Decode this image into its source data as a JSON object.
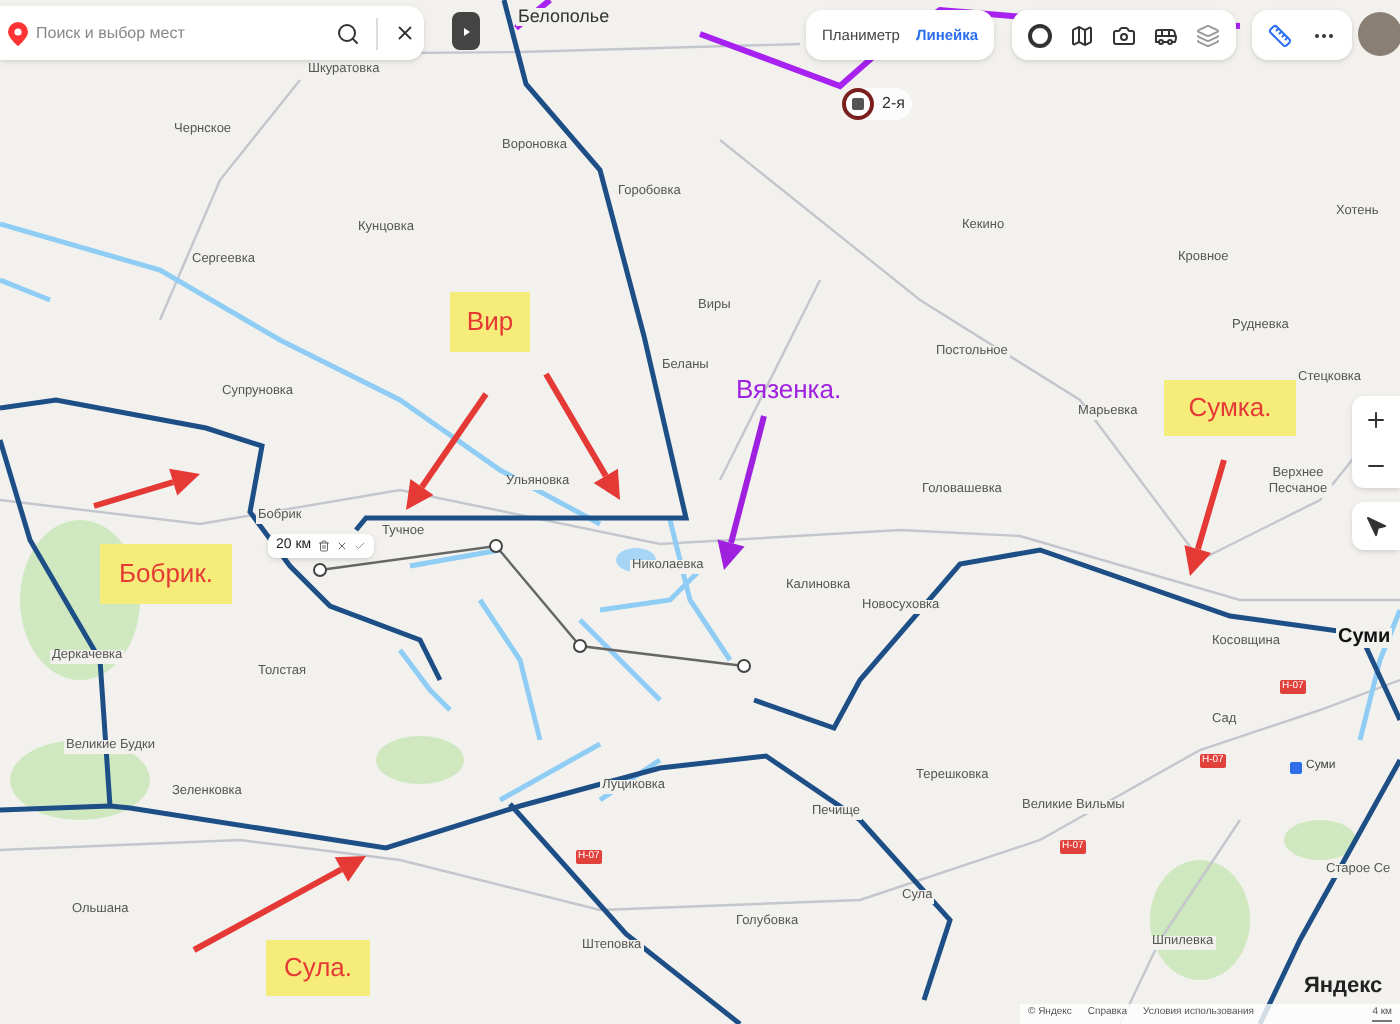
{
  "search": {
    "placeholder": "Поиск и выбор мест"
  },
  "measure_tabs": [
    {
      "label": "Планиметр",
      "selected": false
    },
    {
      "label": "Линейка",
      "selected": true
    }
  ],
  "place_badge": {
    "label": "2-я"
  },
  "ruler": {
    "distance": "20 км"
  },
  "settlements": [
    {
      "name": "Белополье",
      "kind": "town"
    },
    {
      "name": "Шкуратовка",
      "kind": "village"
    },
    {
      "name": "Чернское",
      "kind": "village"
    },
    {
      "name": "Вороновка",
      "kind": "village"
    },
    {
      "name": "Горобовка",
      "kind": "village"
    },
    {
      "name": "Кунцовка",
      "kind": "village"
    },
    {
      "name": "Сергеевка",
      "kind": "village"
    },
    {
      "name": "Виры",
      "kind": "village"
    },
    {
      "name": "Кекино",
      "kind": "village"
    },
    {
      "name": "Кровное",
      "kind": "village"
    },
    {
      "name": "Хотень",
      "kind": "village"
    },
    {
      "name": "Рудневка",
      "kind": "village"
    },
    {
      "name": "Беланы",
      "kind": "village"
    },
    {
      "name": "Постольное",
      "kind": "village"
    },
    {
      "name": "Марьевка",
      "kind": "village"
    },
    {
      "name": "Стецковка",
      "kind": "village"
    },
    {
      "name": "Головашевка",
      "kind": "village"
    },
    {
      "name": "Верхнее Песчаное",
      "kind": "village"
    },
    {
      "name": "Супруновка",
      "kind": "village"
    },
    {
      "name": "Ульяновка",
      "kind": "village"
    },
    {
      "name": "Бобрик",
      "kind": "village"
    },
    {
      "name": "Тучное",
      "kind": "village"
    },
    {
      "name": "Николаевка",
      "kind": "village"
    },
    {
      "name": "Калиновка",
      "kind": "village"
    },
    {
      "name": "Новосуховка",
      "kind": "village"
    },
    {
      "name": "Косовщина",
      "kind": "village"
    },
    {
      "name": "Деркачевка",
      "kind": "village"
    },
    {
      "name": "Толстая",
      "kind": "village"
    },
    {
      "name": "Сад",
      "kind": "village"
    },
    {
      "name": "Великие Будки",
      "kind": "village"
    },
    {
      "name": "Терешковка",
      "kind": "village"
    },
    {
      "name": "Зеленковка",
      "kind": "village"
    },
    {
      "name": "Луциковка",
      "kind": "village"
    },
    {
      "name": "Печище",
      "kind": "village"
    },
    {
      "name": "Великие Вильмы",
      "kind": "village"
    },
    {
      "name": "Старое Се",
      "kind": "village"
    },
    {
      "name": "Ольшана",
      "kind": "village"
    },
    {
      "name": "Сула",
      "kind": "village"
    },
    {
      "name": "Голубовка",
      "kind": "village"
    },
    {
      "name": "Штеповка",
      "kind": "village"
    },
    {
      "name": "Шпилевка",
      "kind": "village"
    },
    {
      "name": "Суми",
      "kind": "city"
    }
  ],
  "station": {
    "label": "Суми"
  },
  "road_signs": [
    "Н-07",
    "Н-07",
    "Н-07",
    "Н-07"
  ],
  "annotations": [
    {
      "text": "Вир",
      "kind": "boxed",
      "color": "#e53935"
    },
    {
      "text": "Бобрик.",
      "kind": "boxed",
      "color": "#e53935"
    },
    {
      "text": "Вязенка.",
      "kind": "plain",
      "color": "#a020e0"
    },
    {
      "text": "Сумка.",
      "kind": "boxed",
      "color": "#e53935"
    },
    {
      "text": "Сула.",
      "kind": "boxed",
      "color": "#e53935"
    }
  ],
  "footer": {
    "copyright": "© Яндекс",
    "help": "Справка",
    "terms": "Условия использования",
    "scale": "4 км",
    "logo": "Яндекс"
  }
}
